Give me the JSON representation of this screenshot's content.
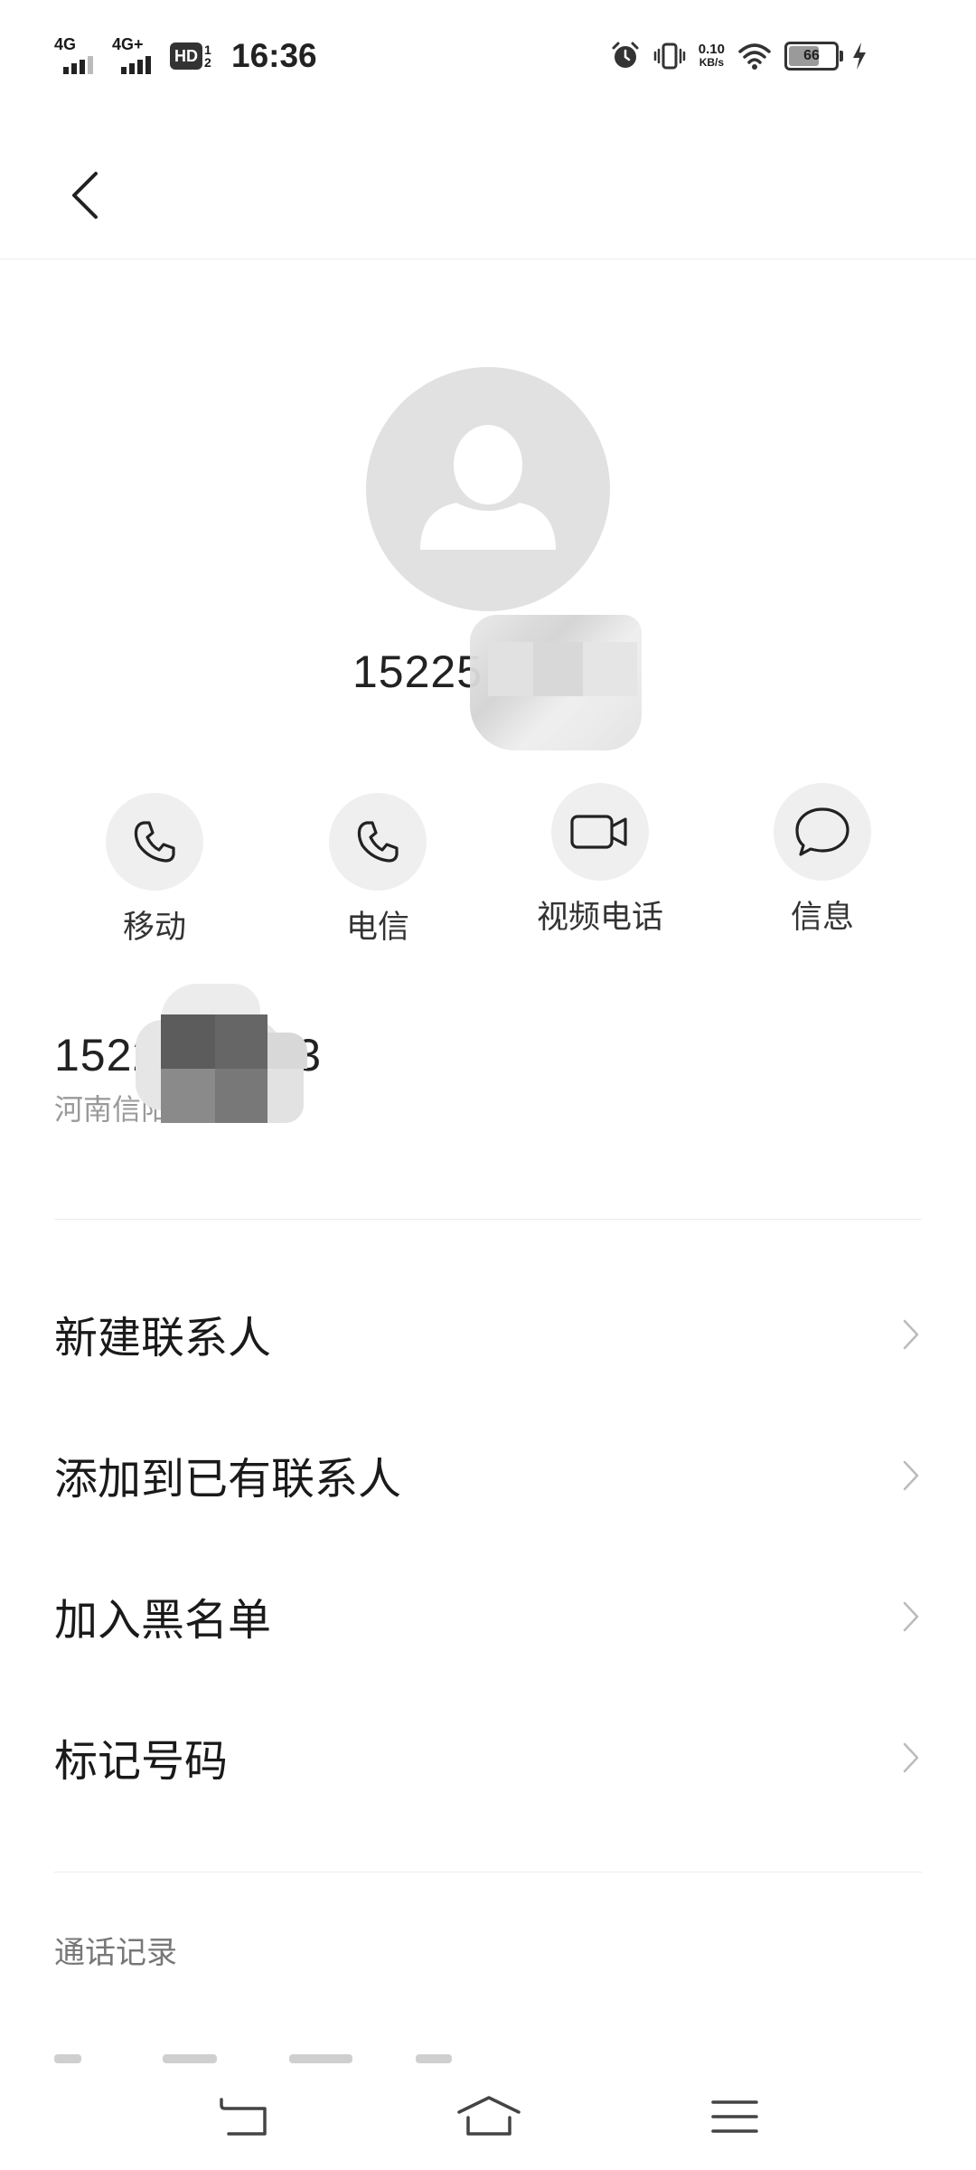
{
  "status_bar": {
    "sim1_network": "4G",
    "sim2_network": "4G+",
    "hd_label": "HD",
    "hd_sub": "1 2",
    "time": "16:36",
    "net_speed_value": "0.10",
    "net_speed_unit": "KB/s",
    "battery_level": "66",
    "icons": [
      "alarm-icon",
      "vibrate-icon",
      "wifi-icon",
      "battery-icon",
      "charging-icon"
    ]
  },
  "header": {
    "back_icon": "chevron-left-icon"
  },
  "contact": {
    "avatar_icon": "person-icon",
    "number_visible": "15225"
  },
  "actions": [
    {
      "label": "移动",
      "icon": "phone-icon"
    },
    {
      "label": "电信",
      "icon": "phone-icon"
    },
    {
      "label": "视频电话",
      "icon": "video-camera-icon"
    },
    {
      "label": "信息",
      "icon": "message-bubble-icon"
    }
  ],
  "number_detail": {
    "number_start": "1522",
    "number_end": "3",
    "location": "河南信阳"
  },
  "menu": [
    {
      "label": "新建联系人"
    },
    {
      "label": "添加到已有联系人"
    },
    {
      "label": "加入黑名单"
    },
    {
      "label": "标记号码"
    }
  ],
  "call_log": {
    "title": "通话记录"
  },
  "nav_bar": {
    "icons": [
      "back-nav-icon",
      "home-nav-icon",
      "menu-nav-icon"
    ]
  },
  "colors": {
    "background": "#ffffff",
    "avatar_bg": "#e1e1e1",
    "action_bg": "#efefef",
    "text_primary": "#1a1a1a",
    "text_secondary": "#999999"
  }
}
